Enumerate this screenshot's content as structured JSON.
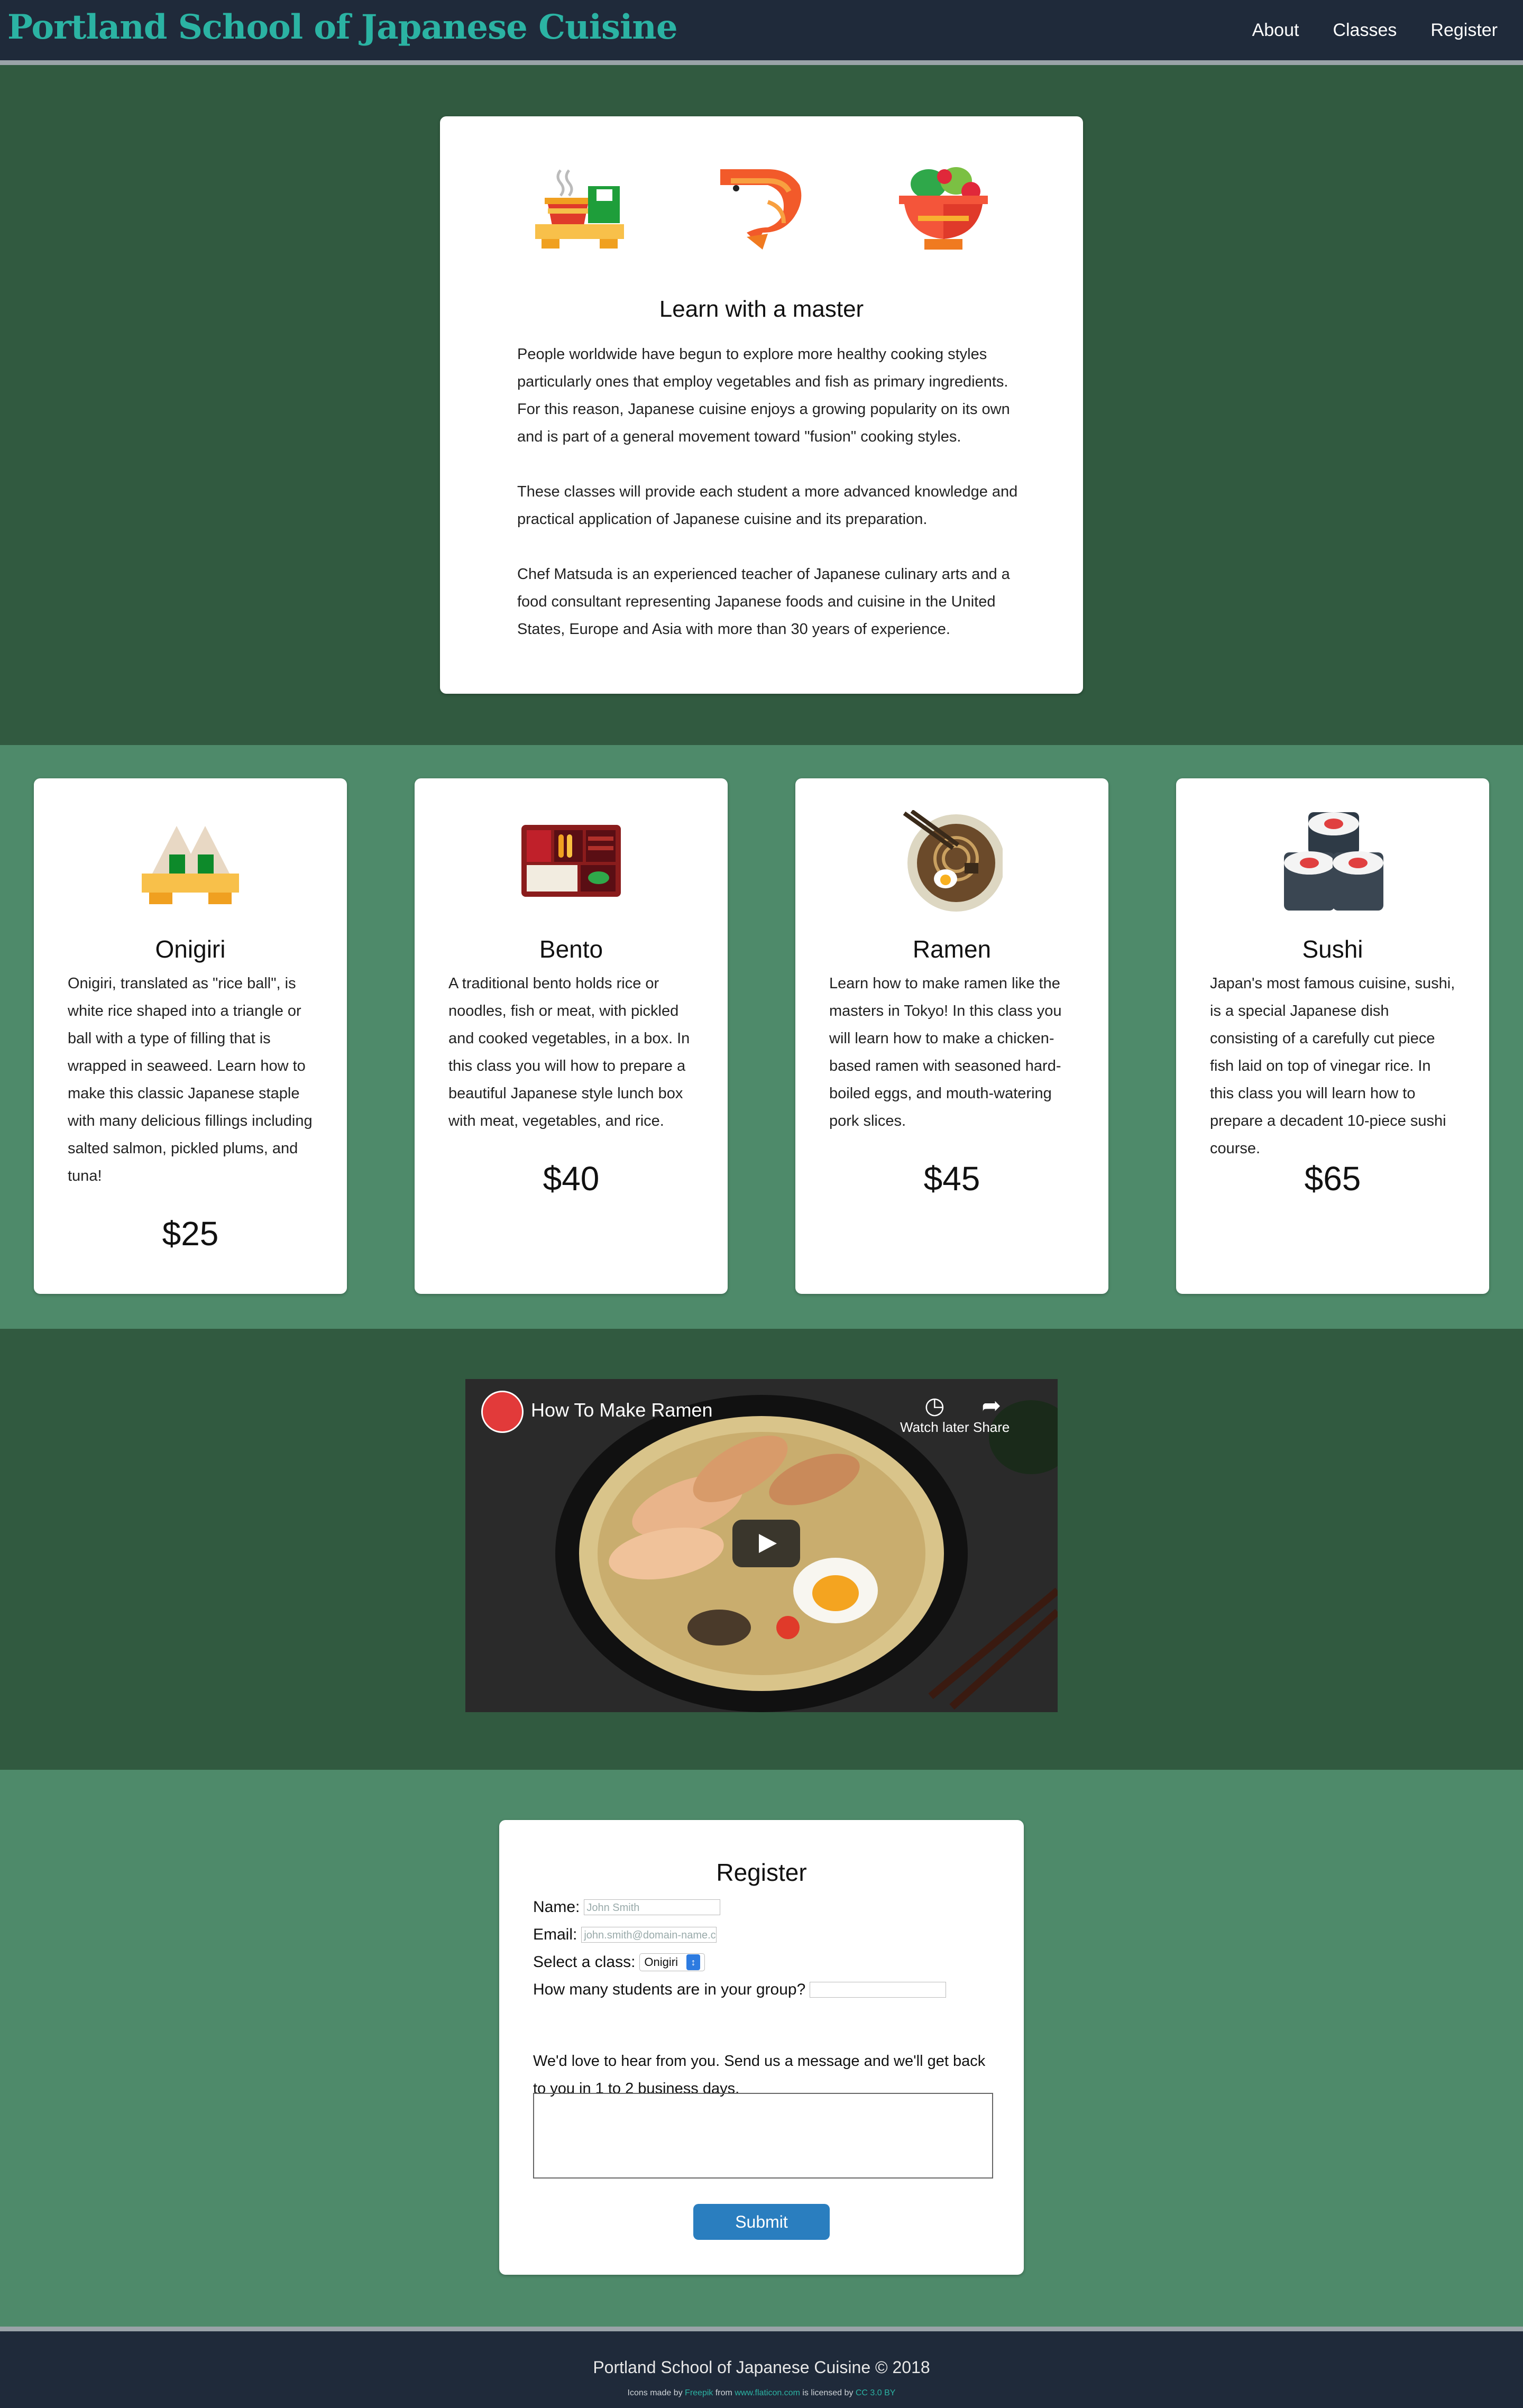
{
  "header": {
    "brand": "Portland School of Japanese Cuisine",
    "nav": [
      "About",
      "Classes",
      "Register"
    ]
  },
  "intro": {
    "icons": [
      "tea-set-icon",
      "shrimp-icon",
      "salad-bowl-icon"
    ],
    "title": "Learn with a master",
    "paragraphs": [
      "People worldwide have begun to explore more healthy cooking styles particularly ones that employ vegetables and fish as primary ingredients. For this reason, Japanese cuisine enjoys a growing popularity on its own and is part of a general movement toward \"fusion\" cooking styles.",
      "These classes will provide each student a more advanced knowledge and practical application of Japanese cuisine and its preparation.",
      "Chef Matsuda is an experienced teacher of Japanese culinary arts and a food consultant representing Japanese foods and cuisine in the United States, Europe and Asia with more than 30 years of experience."
    ]
  },
  "classes": [
    {
      "icon": "onigiri-icon",
      "title": "Onigiri",
      "desc": "Onigiri, translated as \"rice ball\", is white rice shaped into a triangle or ball with a type of filling that is wrapped in seaweed. Learn how to make this classic Japanese staple with many delicious fillings including salted salmon, pickled plums, and tuna!",
      "price": "$25"
    },
    {
      "icon": "bento-icon",
      "title": "Bento",
      "desc": "A traditional bento holds rice or noodles, fish or meat, with pickled and cooked vegetables, in a box. In this class you will how to prepare a beautiful Japanese style lunch box with meat, vegetables, and rice.",
      "price": "$40"
    },
    {
      "icon": "ramen-icon",
      "title": "Ramen",
      "desc": "Learn how to make ramen like the masters in Tokyo! In this class you will learn how to make a chicken-based ramen with seasoned hard-boiled eggs, and mouth-watering pork slices.",
      "price": "$45"
    },
    {
      "icon": "sushi-icon",
      "title": "Sushi",
      "desc": "Japan's most famous cuisine, sushi, is a special Japanese dish consisting of a carefully cut piece fish laid on top of vinegar rice. In this class you will learn how to prepare a decadent 10-piece sushi course.",
      "price": "$65"
    }
  ],
  "video": {
    "title": "How To Make Ramen",
    "watch_later": "Watch later",
    "share": "Share"
  },
  "register": {
    "title": "Register",
    "name_label": "Name:",
    "name_placeholder": "John Smith",
    "email_label": "Email:",
    "email_placeholder": "john.smith@domain-name.com",
    "class_label": "Select a class:",
    "class_selected": "Onigiri",
    "group_label": "How many students are in your group?",
    "message": "We'd love to hear from you. Send us a message and we'll get back to you in 1 to 2 business days.",
    "submit": "Submit"
  },
  "footer": {
    "main": "Portland School of Japanese Cuisine © 2018",
    "credit_prefix": "Icons made by",
    "credit_author": "Freepik",
    "credit_from": "from",
    "credit_site": "www.flaticon.com",
    "credit_licensed": "is licensed by",
    "credit_license": "CC 3.0 BY"
  },
  "colors": {
    "header_bg": "#1f2a3a",
    "brand": "#2bb3a3",
    "dark_band": "#315a40",
    "light_band": "#4e8a6a",
    "submit": "#2a7ebf"
  }
}
